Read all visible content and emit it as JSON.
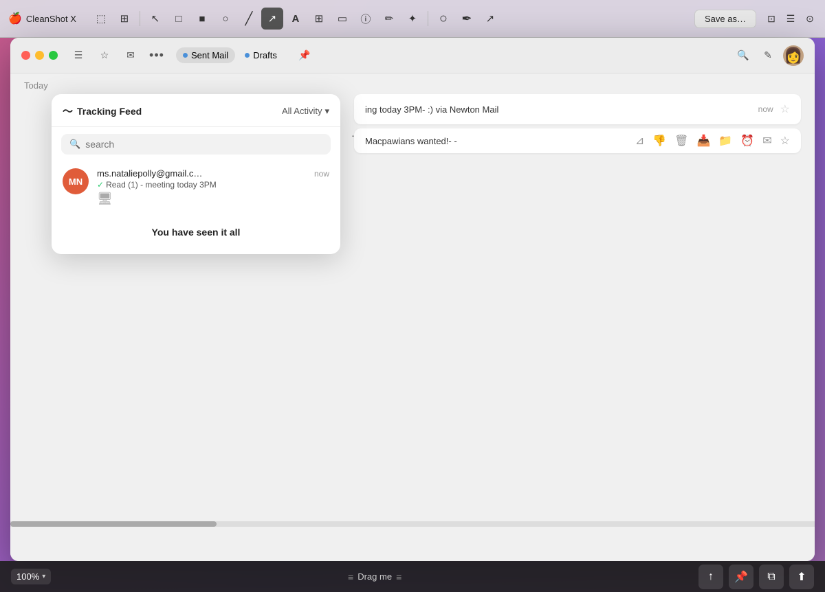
{
  "cleanshot": {
    "app_name": "CleanShot X",
    "save_button": "Save as…",
    "tools": [
      {
        "id": "crop",
        "icon": "⬚",
        "label": "crop-tool"
      },
      {
        "id": "capture-ui",
        "icon": "⊞",
        "label": "capture-ui-tool"
      },
      {
        "id": "pointer",
        "icon": "↖",
        "label": "pointer-tool"
      },
      {
        "id": "rect",
        "icon": "□",
        "label": "rect-tool"
      },
      {
        "id": "filled-rect",
        "icon": "■",
        "label": "filled-rect-tool"
      },
      {
        "id": "circle",
        "icon": "○",
        "label": "circle-tool"
      },
      {
        "id": "line",
        "icon": "/",
        "label": "line-tool"
      },
      {
        "id": "arrow",
        "icon": "↗",
        "label": "arrow-tool",
        "active": true
      },
      {
        "id": "text",
        "icon": "A",
        "label": "text-tool"
      },
      {
        "id": "pixelate",
        "icon": "⊞",
        "label": "pixelate-tool"
      },
      {
        "id": "highlight",
        "icon": "▭",
        "label": "highlight-tool"
      },
      {
        "id": "circle-i",
        "icon": "ⓘ",
        "label": "info-tool"
      },
      {
        "id": "pencil",
        "icon": "✏",
        "label": "pencil-tool"
      },
      {
        "id": "stamp",
        "icon": "✦",
        "label": "stamp-tool"
      }
    ],
    "color_tools": [
      {
        "id": "color-fill",
        "label": "color-fill-btn"
      },
      {
        "id": "pen-color",
        "label": "pen-color-btn"
      },
      {
        "id": "arrow-color",
        "label": "arrow-color-btn"
      }
    ],
    "system_icons": [
      {
        "id": "capture",
        "icon": "⊡"
      },
      {
        "id": "list",
        "icon": "☰"
      },
      {
        "id": "record",
        "icon": "⊙"
      }
    ]
  },
  "app_window": {
    "title": "",
    "traffic_lights": {
      "red": "close",
      "yellow": "minimize",
      "green": "maximize"
    },
    "toolbar_buttons": [
      {
        "id": "hamburger",
        "icon": "☰"
      },
      {
        "id": "star",
        "icon": "☆"
      },
      {
        "id": "compose",
        "icon": "✉"
      },
      {
        "id": "more",
        "icon": "•••"
      }
    ],
    "tabs": [
      {
        "label": "Sent Mail",
        "active": true,
        "dot_color": "blue"
      },
      {
        "label": "Drafts",
        "active": false,
        "dot_color": "blue"
      }
    ],
    "pin_icon": "📌",
    "search_icon": "🔍",
    "edit_icon": "✎"
  },
  "tracking_popup": {
    "title": "Tracking Feed",
    "title_icon": "📈",
    "filter_label": "All Activity",
    "filter_chevron": "▾",
    "search_placeholder": "search",
    "feed_items": [
      {
        "initials": "MN",
        "avatar_color": "#e05c3a",
        "email": "ms.nataliepolly@gmail.c…",
        "time": "now",
        "description": "Read (1) - meeting today 3PM",
        "device_icon": "🖥"
      }
    ],
    "seen_all_message": "You have seen it all"
  },
  "mail_list": {
    "items": [
      {
        "subject": "ing today 3PM- :) via Newton Mail",
        "time": "now",
        "starred": false
      }
    ],
    "action_bar": {
      "subject": "Macpawians wanted!- -",
      "actions": [
        "filter",
        "thumbsdown",
        "trash",
        "archive",
        "folder",
        "clock",
        "envelope",
        "star"
      ]
    }
  },
  "bottom_bar": {
    "zoom_level": "100%",
    "zoom_chevron": "▾",
    "drag_label": "Drag me",
    "action_buttons": [
      {
        "id": "share",
        "icon": "↑"
      },
      {
        "id": "pin",
        "icon": "📌"
      },
      {
        "id": "layers",
        "icon": "⧉"
      },
      {
        "id": "upload",
        "icon": "⬆"
      }
    ]
  }
}
